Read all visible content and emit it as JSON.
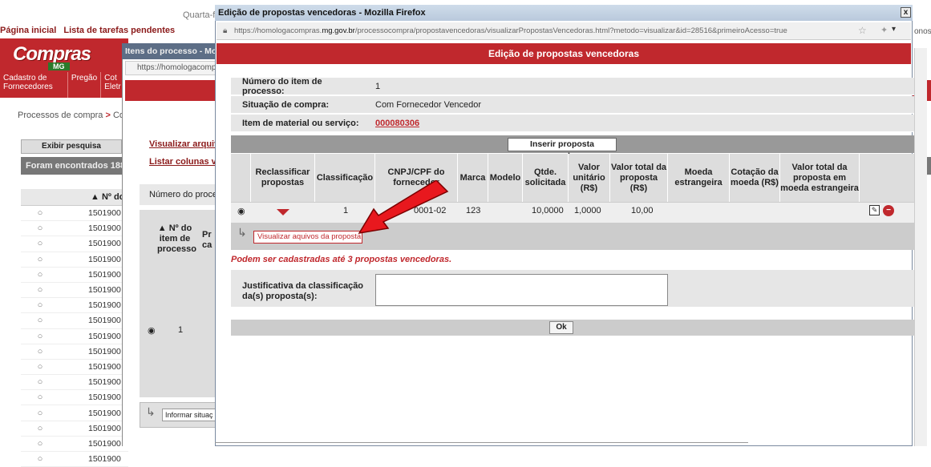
{
  "background": {
    "date_fragment": "Quarta-f",
    "nav": [
      "Página inicial",
      "Lista de tarefas pendentes"
    ],
    "logo_text": "Compras",
    "logo_sub": "MG",
    "menu": [
      "Cadastro de Fornecedores",
      "Pregão",
      "Cot Eletr"
    ],
    "breadcrumb_start": "Processos de compra",
    "breadcrumb_sep": " > ",
    "breadcrumb_end": "Com",
    "exibir_button": "Exibir pesquisa",
    "found_text": "Foram encontrados 188",
    "list_header": "▲ Nº do",
    "rows": [
      "1501900",
      "1501900",
      "1501900",
      "1501900",
      "1501900",
      "1501900",
      "1501900",
      "1501900",
      "1501900",
      "1501900",
      "1501900",
      "1501900",
      "1501900",
      "1501900",
      "1501900",
      "1501900",
      "1501900"
    ],
    "right_fragment": "onosc"
  },
  "middle_window": {
    "title": "Itens do processo - Mo",
    "url": "https://homologacomp",
    "link_visualizar": "Visualizar arquivo",
    "link_listar": "Listar colunas vis",
    "numero_header": "Número do proce",
    "nheader": "▲ Nº do item de processo",
    "pr_fragment": "Pr ca",
    "radio_row_value": "1",
    "informar_button": "Informar situaç"
  },
  "window": {
    "title": "Edição de propostas vencedoras - Mozilla Firefox",
    "close": "x",
    "url_prefix": "https://homologacompras.",
    "url_domain": "mg.gov.br",
    "url_suffix": "/processocompra/propostavencedoras/visualizarPropostasVencedoras.html?metodo=visualizar&id=28516&primeiroAcesso=true",
    "header": "Edição de propostas vencedoras"
  },
  "info": {
    "numero_label": "Número do item de processo:",
    "numero_value": "1",
    "situacao_label": "Situação de compra:",
    "situacao_value": "Com Fornecedor Vencedor",
    "item_label": "Item de material ou serviço:",
    "item_value": "000080306"
  },
  "inserir_button": "Inserir proposta vencedora",
  "table": {
    "headers": [
      "Reclassificar propostas",
      "Classificação",
      "CNPJ/CPF do fornecedor",
      "Marca",
      "Modelo",
      "Qtde. solicitada",
      "Valor unitário (R$)",
      "Valor total da proposta (R$)",
      "Moeda estrangeira",
      "Cotação da moeda (R$)",
      "Valor total da proposta em moeda estrangeira"
    ],
    "row": {
      "classificacao": "1",
      "cnpj": "0001-02",
      "marca": "123",
      "modelo": "",
      "qtde": "10,0000",
      "valor_unitario": "1,0000",
      "valor_total": "10,00"
    }
  },
  "files_button": "Visualizar aquivos da proposta",
  "note": "Podem ser cadastradas até 3 propostas vencedoras.",
  "justificativa_label": "Justificativa da classificação da(s) proposta(s):",
  "ok_button": "Ok",
  "colors": {
    "brand_red": "#c0282d",
    "annotation_red": "#e8181e"
  }
}
